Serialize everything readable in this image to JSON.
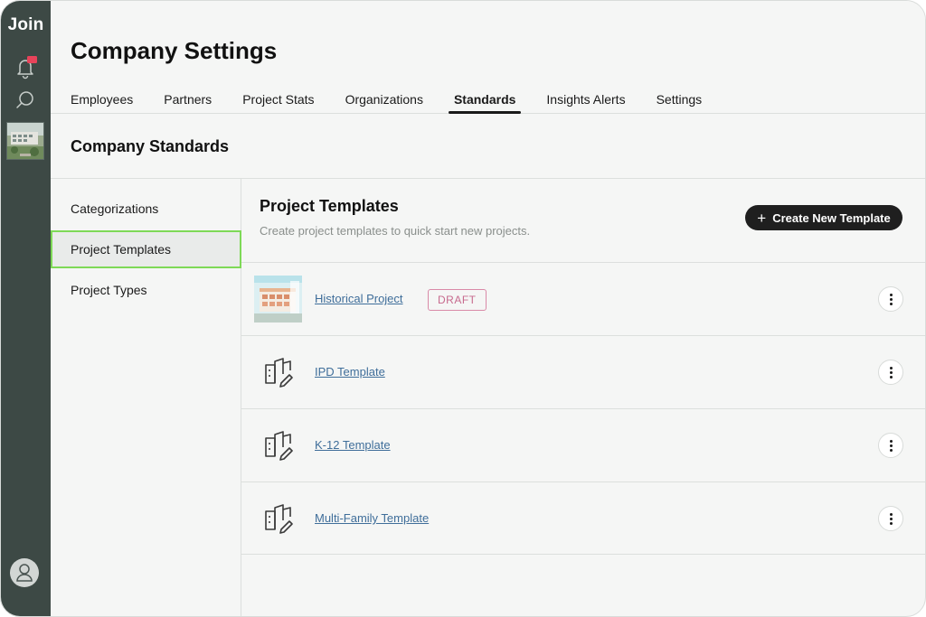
{
  "app": {
    "logo": "Join"
  },
  "rail": {
    "icons": [
      "bell-icon",
      "search-icon"
    ],
    "notification_color": "#e8435a"
  },
  "header": {
    "title": "Company Settings",
    "tabs": [
      {
        "label": "Employees"
      },
      {
        "label": "Partners"
      },
      {
        "label": "Project Stats"
      },
      {
        "label": "Organizations"
      },
      {
        "label": "Standards",
        "active": true
      },
      {
        "label": "Insights Alerts"
      },
      {
        "label": "Settings"
      }
    ]
  },
  "section": {
    "title": "Company Standards"
  },
  "sidenav": {
    "items": [
      {
        "label": "Categorizations"
      },
      {
        "label": "Project Templates",
        "active": true
      },
      {
        "label": "Project Types"
      }
    ]
  },
  "content": {
    "title": "Project Templates",
    "subtitle": "Create project templates to quick start new projects.",
    "create_button": "Create New Template",
    "templates": [
      {
        "name": "Historical Project",
        "badge": "DRAFT",
        "thumb": "image"
      },
      {
        "name": "IPD Template",
        "thumb": "building-icon"
      },
      {
        "name": "K-12 Template",
        "thumb": "building-icon"
      },
      {
        "name": "Multi-Family Template",
        "thumb": "building-icon"
      }
    ]
  },
  "colors": {
    "rail": "#3d4945",
    "active_nav_border": "#7ed957",
    "link": "#3f6e9a",
    "draft_badge": "#c76a8e"
  }
}
